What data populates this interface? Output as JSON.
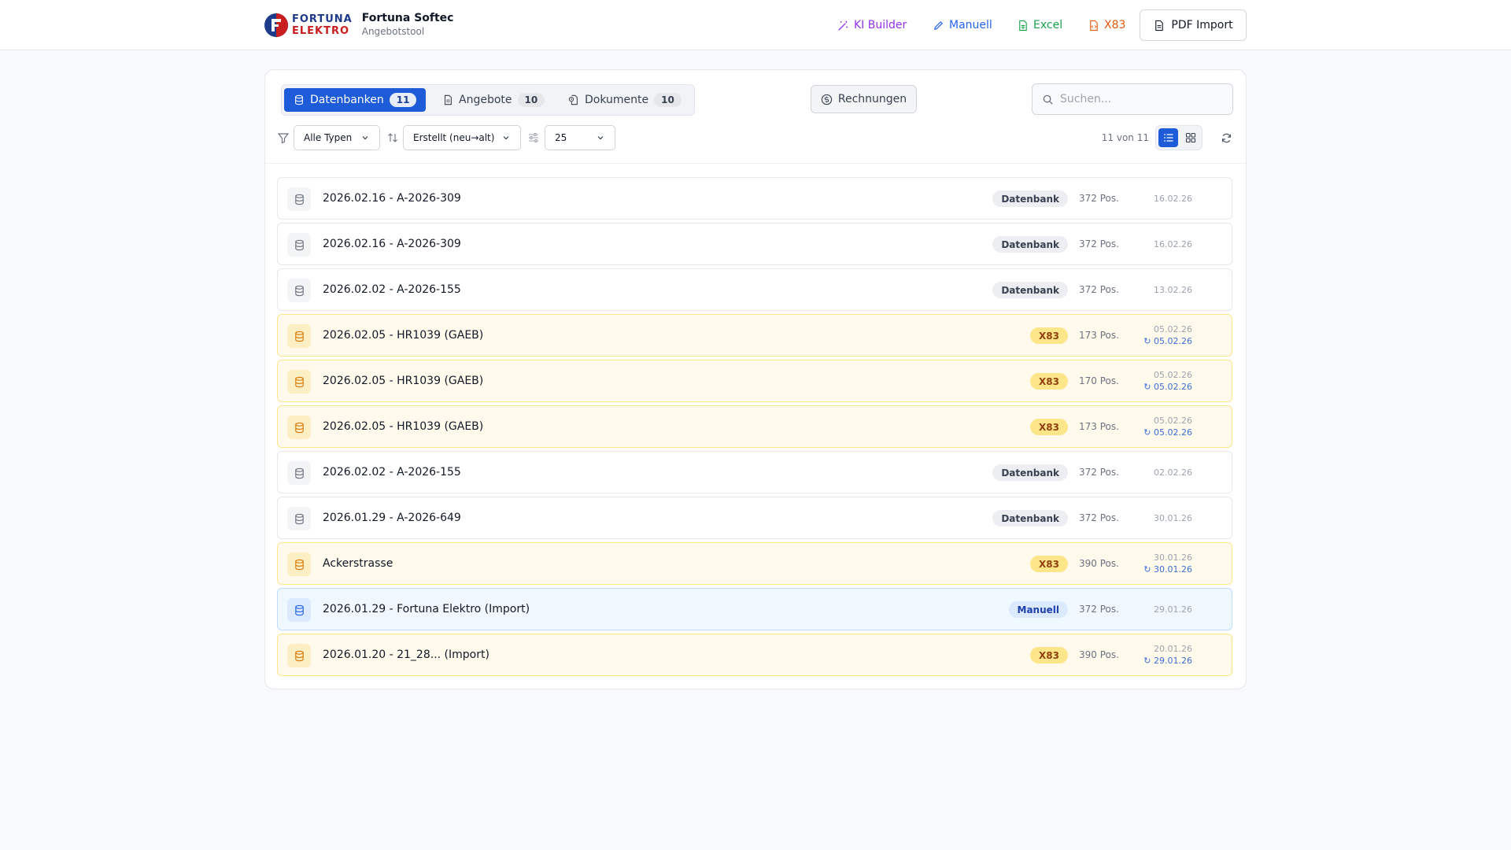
{
  "brand": {
    "logo_line1": "FORTUNA",
    "logo_line2": "ELEKTRO",
    "app_title": "Fortuna Softec",
    "app_subtitle": "Angebotstool"
  },
  "nav": {
    "ki_builder": "KI Builder",
    "manuell": "Manuell",
    "excel": "Excel",
    "x83": "X83",
    "pdf_import": "PDF Import"
  },
  "tabs": [
    {
      "label": "Datenbanken",
      "count": "11"
    },
    {
      "label": "Angebote",
      "count": "10"
    },
    {
      "label": "Dokumente",
      "count": "10"
    }
  ],
  "rechnungen_label": "Rechnungen",
  "search": {
    "placeholder": "Suchen..."
  },
  "filters": {
    "type": "Alle Typen",
    "sort": "Erstellt (neu→alt)",
    "page_size": "25",
    "result_count": "11 von 11"
  },
  "colors": {
    "accent": "#1d5bd8",
    "x83": "#d97706",
    "manuell": "#2563eb",
    "ki": "#9333ea",
    "excel": "#16a34a"
  },
  "rows": [
    {
      "title": "2026.02.16 - A-2026-309",
      "badge": "Datenbank",
      "kind": "db",
      "positions": "372 Pos.",
      "created": "16.02.26",
      "updated": ""
    },
    {
      "title": "2026.02.16 - A-2026-309",
      "badge": "Datenbank",
      "kind": "db",
      "positions": "372 Pos.",
      "created": "16.02.26",
      "updated": ""
    },
    {
      "title": "2026.02.02 - A-2026-155",
      "badge": "Datenbank",
      "kind": "db",
      "positions": "372 Pos.",
      "created": "13.02.26",
      "updated": ""
    },
    {
      "title": "2026.02.05 - HR1039 (GAEB)",
      "badge": "X83",
      "kind": "x83",
      "positions": "173 Pos.",
      "created": "05.02.26",
      "updated": "↻ 05.02.26"
    },
    {
      "title": "2026.02.05 - HR1039 (GAEB)",
      "badge": "X83",
      "kind": "x83",
      "positions": "170 Pos.",
      "created": "05.02.26",
      "updated": "↻ 05.02.26"
    },
    {
      "title": "2026.02.05 - HR1039 (GAEB)",
      "badge": "X83",
      "kind": "x83",
      "positions": "173 Pos.",
      "created": "05.02.26",
      "updated": "↻ 05.02.26"
    },
    {
      "title": "2026.02.02 - A-2026-155",
      "badge": "Datenbank",
      "kind": "db",
      "positions": "372 Pos.",
      "created": "02.02.26",
      "updated": ""
    },
    {
      "title": "2026.01.29 - A-2026-649",
      "badge": "Datenbank",
      "kind": "db",
      "positions": "372 Pos.",
      "created": "30.01.26",
      "updated": ""
    },
    {
      "title": "Ackerstrasse",
      "badge": "X83",
      "kind": "x83",
      "positions": "390 Pos.",
      "created": "30.01.26",
      "updated": "↻ 30.01.26"
    },
    {
      "title": "2026.01.29 - Fortuna Elektro (Import)",
      "badge": "Manuell",
      "kind": "manuell",
      "positions": "372 Pos.",
      "created": "29.01.26",
      "updated": ""
    },
    {
      "title": "2026.01.20 - 21_28... (Import)",
      "badge": "X83",
      "kind": "x83",
      "positions": "390 Pos.",
      "created": "20.01.26",
      "updated": "↻ 29.01.26"
    }
  ]
}
